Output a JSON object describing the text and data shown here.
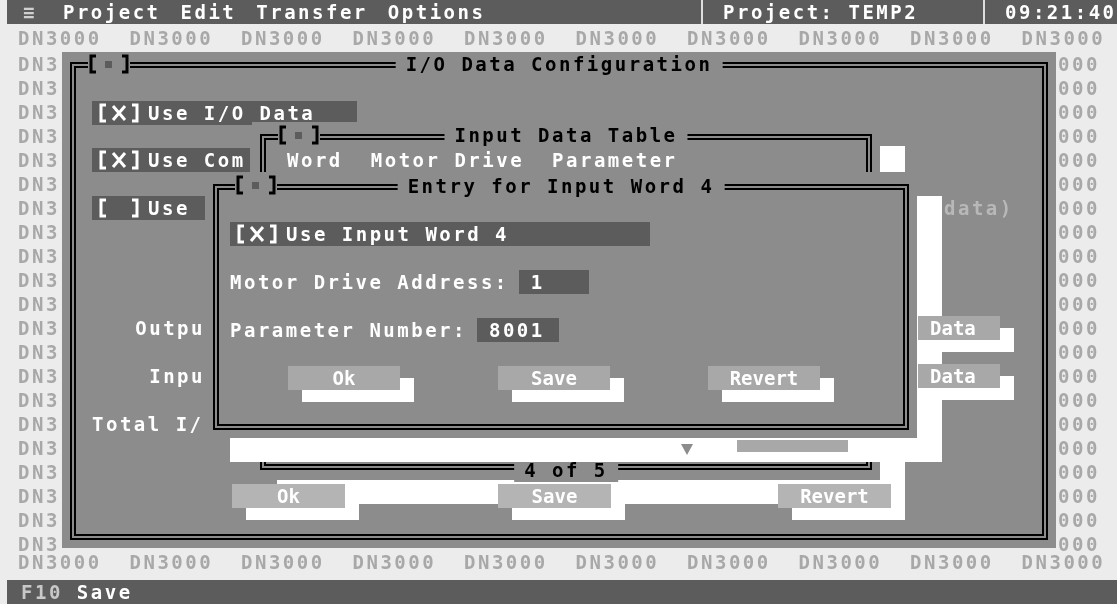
{
  "menu_bar": {
    "menu_icon": "≡",
    "menus": [
      "Project",
      "Edit",
      "Transfer",
      "Options"
    ],
    "project": "Project: TEMP2",
    "clock": "09:21:40"
  },
  "backdrop": {
    "top_row": "DN3000  DN3000  DN3000  DN3000  DN3000  DN3000  DN3000  DN3000  DN3000  DN3000",
    "bottom_row": "DN3000  DN3000  DN3000  DN3000  DN3000  DN3000  DN3000  DN3000  DN3000  DN3000",
    "left_column": [
      "DN3",
      "DN3",
      "DN3",
      "DN3",
      "DN3",
      "DN3",
      "DN3",
      "DN3",
      "DN3",
      "DN3",
      "DN3",
      "DN3",
      "DN3",
      "DN3",
      "DN3",
      "DN3",
      "DN3",
      "DN3",
      "DN3",
      "DN3",
      "DN3"
    ],
    "right_column": [
      "000",
      "000",
      "000",
      "000",
      "000",
      "000",
      "000",
      "000",
      "000",
      "000",
      "000",
      "000",
      "000",
      "000",
      "000",
      "000",
      "000",
      "000",
      "000",
      "000",
      "000"
    ]
  },
  "config_window": {
    "title": "I/O Data Configuration",
    "checkboxes": [
      {
        "label": "Use I/O Data",
        "checked": true
      },
      {
        "label": "Use Com",
        "checked": true
      },
      {
        "label": "Use",
        "checked": false
      }
    ],
    "note": "data)",
    "labels": [
      "Outpu",
      "Inpu",
      "Total I/"
    ],
    "side_buttons": [
      "Data",
      "Data"
    ],
    "buttons": [
      "Ok",
      "Save",
      "Revert"
    ]
  },
  "input_table": {
    "title": "Input Data Table",
    "columns": [
      "Word",
      "Motor Drive",
      "Parameter"
    ],
    "pager": "4 of 5"
  },
  "entry_dialog": {
    "title": "Entry for Input Word 4",
    "checkbox": {
      "label": "Use Input Word 4",
      "checked": true
    },
    "fields": [
      {
        "label": "Motor Drive Address:",
        "value": "1"
      },
      {
        "label": "Parameter Number:",
        "value": "8001"
      }
    ],
    "buttons": [
      "Ok",
      "Save",
      "Revert"
    ]
  },
  "status_bar": {
    "key": "F10",
    "action": "Save"
  }
}
